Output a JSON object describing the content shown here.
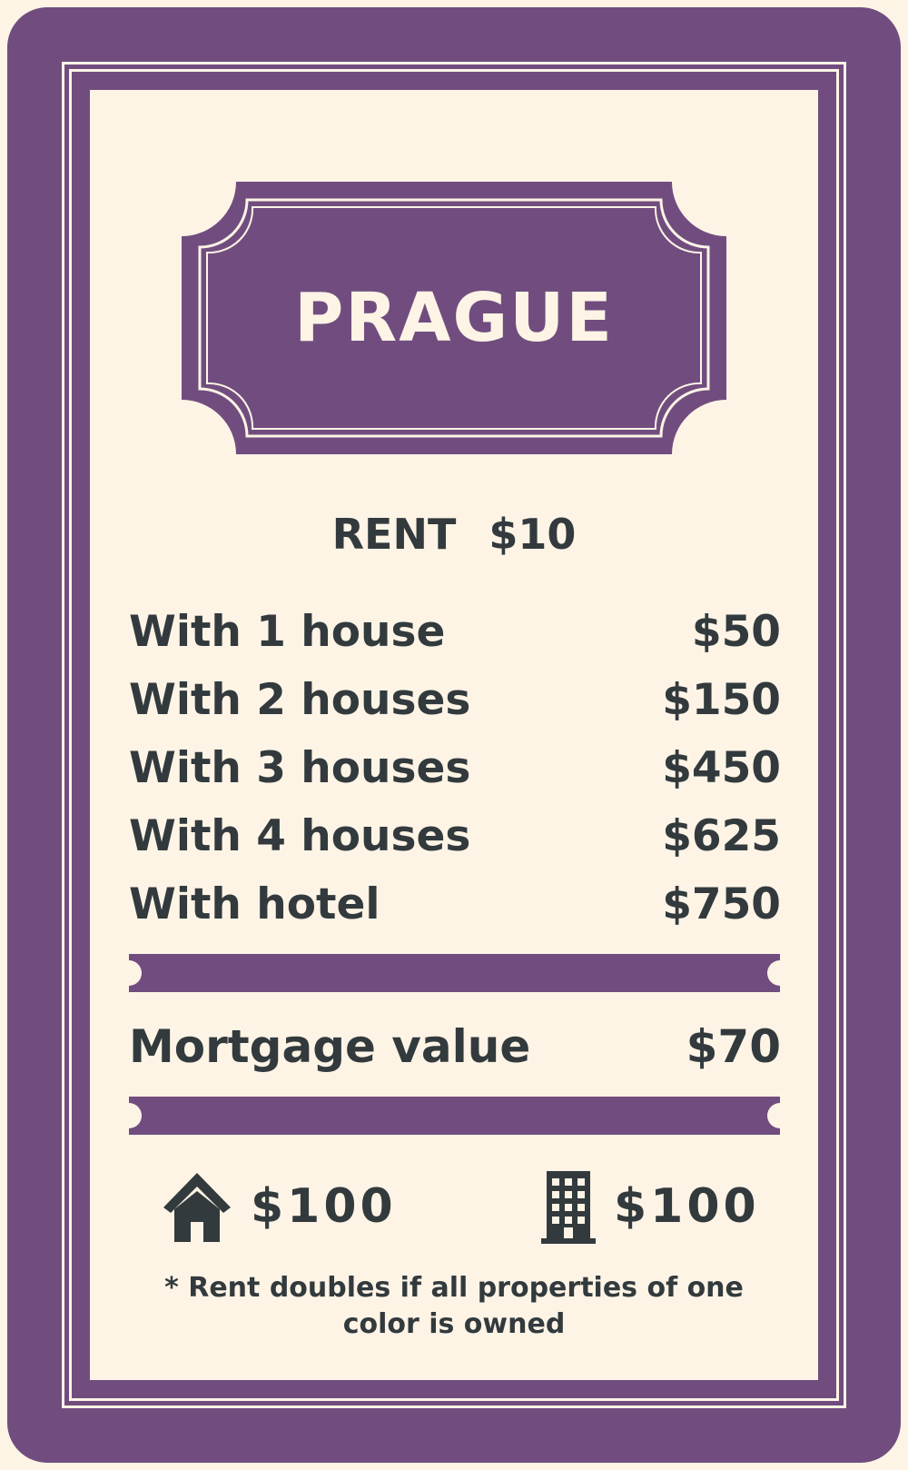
{
  "card": {
    "title": "PRAGUE",
    "rent": {
      "label": "RENT",
      "value": "$10"
    },
    "rent_rows": [
      {
        "label": "With 1 house",
        "value": "$50"
      },
      {
        "label": "With 2 houses",
        "value": "$150"
      },
      {
        "label": "With 3 houses",
        "value": "$450"
      },
      {
        "label": "With 4 houses",
        "value": "$625"
      },
      {
        "label": "With hotel",
        "value": "$750"
      }
    ],
    "mortgage": {
      "label": "Mortgage value",
      "value": "$70"
    },
    "house_cost": {
      "icon": "house-icon",
      "value": "$100"
    },
    "hotel_cost": {
      "icon": "building-icon",
      "value": "$100"
    },
    "note": "* Rent doubles if all properties of one color is owned"
  },
  "colors": {
    "accent": "#714d7f",
    "background": "#fdf4e6",
    "text": "#333a3d"
  }
}
